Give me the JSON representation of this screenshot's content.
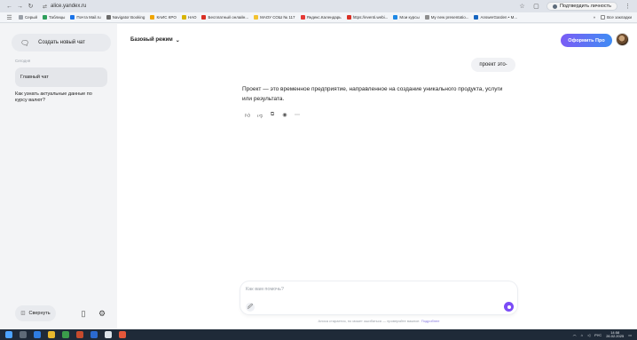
{
  "browser": {
    "url": "alice.yandex.ru",
    "confirm_label": "Подтвердить личность",
    "nav_icons": [
      "arrow-left-icon",
      "arrow-right-icon",
      "reload-icon",
      "site-settings-icon"
    ],
    "bookmarks": [
      {
        "label": "Серый",
        "color": "#9aa0a8"
      },
      {
        "label": "Таблицы",
        "color": "#2e9e5b"
      },
      {
        "label": "Почта Mail.ru",
        "color": "#1a73e8"
      },
      {
        "label": "Navigator Booking",
        "color": "#6b6b6b"
      },
      {
        "label": "КАИС КРО",
        "color": "#f0a500"
      },
      {
        "label": "НАО",
        "color": "#d8b400"
      },
      {
        "label": "Бесплатный онлайн...",
        "color": "#d93025"
      },
      {
        "label": "МАОУ СОШ № 117",
        "color": "#f2c230"
      },
      {
        "label": "Яндекс.Календарь",
        "color": "#e53935"
      },
      {
        "label": "https://eventi.webi...",
        "color": "#d93025"
      },
      {
        "label": "Мои курсы",
        "color": "#1e88e5"
      },
      {
        "label": "My new presentatio...",
        "color": "#8e8e8e"
      },
      {
        "label": "AnswerGarden • M...",
        "color": "#1565c0"
      }
    ],
    "all_bookmarks_label": "Все закладки"
  },
  "sidebar": {
    "new_chat_label": "Создать новый чат",
    "section_label": "Сегодня",
    "active_chat": "Главный чат",
    "chats": [
      "Как узнать актуальные данные по курсу валют?"
    ],
    "collapse_label": "Свернуть"
  },
  "header": {
    "mode_label": "Базовый режим",
    "pro_label": "Оформить Про"
  },
  "conversation": {
    "user_message": "проект это-",
    "assistant_answer": "Проект — это временное предприятие, направленное на создание уникального продукта, услуги или результата.",
    "actions": [
      "thumbs-up-icon",
      "thumbs-down-icon",
      "copy-icon",
      "speaker-icon",
      "more-icon"
    ]
  },
  "composer": {
    "placeholder": "Как вам помочь?",
    "disclaimer": "Алиса старается, но может ошибаться — проверяйте важное.",
    "disclaimer_link": "Подробнее"
  },
  "taskbar": {
    "lang": "РУС",
    "time": "14:58",
    "date": "26.02.2025"
  }
}
